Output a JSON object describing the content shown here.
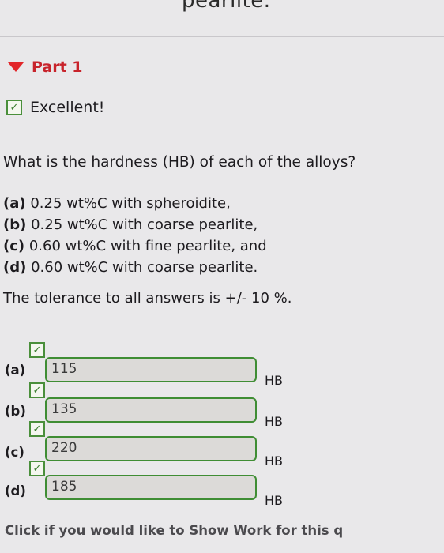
{
  "header_cut_text": "pearlite.",
  "part": {
    "title": "Part 1"
  },
  "status": {
    "text": "Excellent!"
  },
  "question": "What is the hardness (HB) of each of the alloys?",
  "alloys": [
    {
      "tag": "(a)",
      "text": " 0.25 wt%C with spheroidite,"
    },
    {
      "tag": "(b)",
      "text": " 0.25 wt%C with coarse pearlite,"
    },
    {
      "tag": "(c)",
      "text": " 0.60 wt%C with fine pearlite, and"
    },
    {
      "tag": "(d)",
      "text": " 0.60 wt%C with coarse pearlite."
    }
  ],
  "tolerance": "The tolerance to all answers is +/- 10 %.",
  "answers": [
    {
      "label": "(a)",
      "value": "115",
      "unit": "HB"
    },
    {
      "label": "(b)",
      "value": "135",
      "unit": "HB"
    },
    {
      "label": "(c)",
      "value": "220",
      "unit": "HB"
    },
    {
      "label": "(d)",
      "value": "185",
      "unit": "HB"
    }
  ],
  "show_work": "Click if you would like to Show Work for this q",
  "icons": {
    "check": "check-icon",
    "triangle": "triangle-down-icon"
  },
  "colors": {
    "accent": "#c8232b",
    "success": "#3f8d34"
  }
}
